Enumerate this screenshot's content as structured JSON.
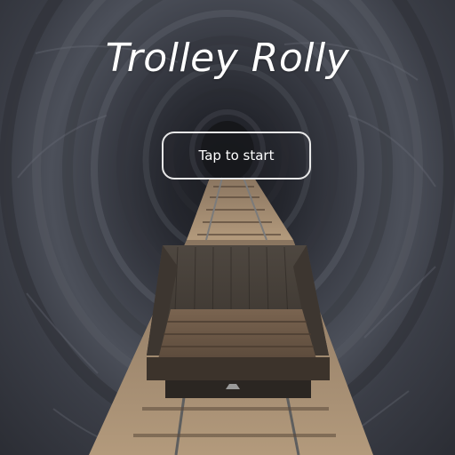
{
  "game": {
    "title": "Trolley Rolly",
    "start_label": "Tap to start"
  },
  "colors": {
    "rock_dark": "#1b1c21",
    "rock_mid": "#4c505a",
    "track_wood": "#a08468",
    "cart_wood": "#5a4a3a",
    "rail_metal": "#6e6e6e",
    "button_border": "#e8e8e8",
    "text": "#ffffff"
  }
}
